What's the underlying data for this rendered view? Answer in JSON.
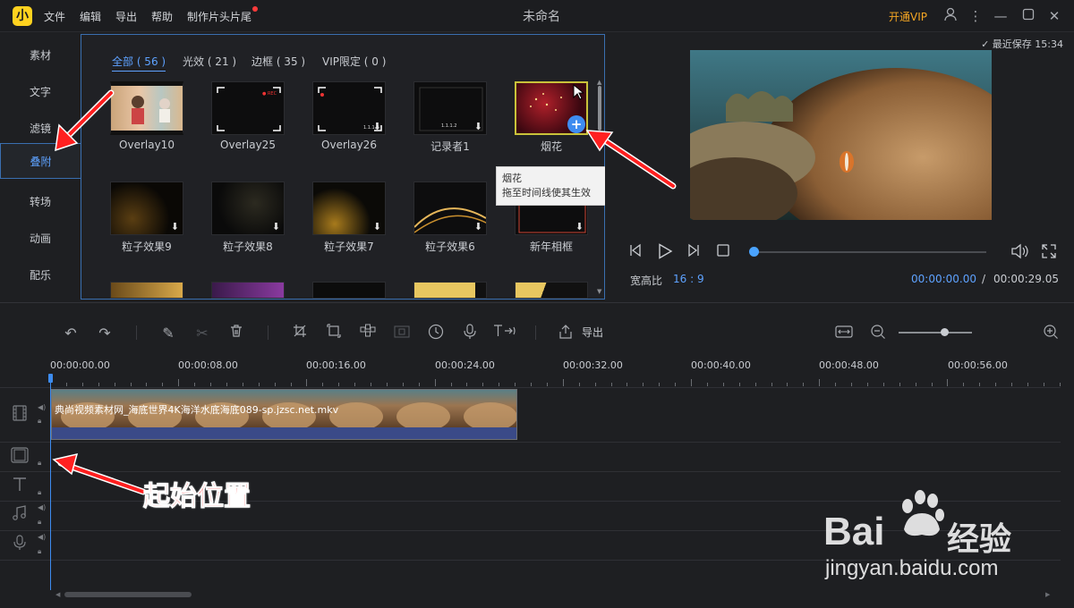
{
  "titlebar": {
    "logo": "小",
    "menus": [
      "文件",
      "编辑",
      "导出",
      "帮助",
      "制作片头片尾"
    ],
    "title": "未命名",
    "vip": "开通VIP"
  },
  "sidebar": {
    "items": [
      "素材",
      "文字",
      "滤镜",
      "叠附",
      "转场",
      "动画",
      "配乐"
    ],
    "active": "叠附"
  },
  "filters": [
    {
      "label": "全部 ( 56 )",
      "active": true
    },
    {
      "label": "光效 ( 21 )"
    },
    {
      "label": "边框 ( 35 )"
    },
    {
      "label": "VIP限定 ( 0 )"
    }
  ],
  "thumbs_row1": [
    "Overlay10",
    "Overlay25",
    "Overlay26",
    "记录者1",
    "烟花"
  ],
  "thumbs_row2": [
    "粒子效果9",
    "粒子效果8",
    "粒子效果7",
    "粒子效果6",
    "新年相框"
  ],
  "tooltip": {
    "title": "烟花",
    "desc": "拖至时间线使其生效"
  },
  "preview": {
    "saved": "最近保存 15:34",
    "ratio_label": "宽高比",
    "ratio_value": "16 : 9",
    "time_current": "00:00:00.00",
    "time_sep": "/",
    "time_total": "00:00:29.05",
    "progress": 0
  },
  "toolbar": {
    "export": "导出"
  },
  "ruler": [
    "00:00:00.00",
    "00:00:08.00",
    "00:00:16.00",
    "00:00:24.00",
    "00:00:32.00",
    "00:00:40.00",
    "00:00:48.00",
    "00:00:56.00"
  ],
  "clip": {
    "name": "典尚视频素材网_海底世界4K海洋水底海底089-sp.jzsc.net.mkv"
  },
  "annotation": "起始位置",
  "watermark": {
    "brand": "Bai",
    "brand2": "经验",
    "url": "jingyan.baidu.com"
  },
  "colors": {
    "accent": "#5ea2ff",
    "vip": "#f5a623",
    "annotation": "#ff2d2d"
  }
}
